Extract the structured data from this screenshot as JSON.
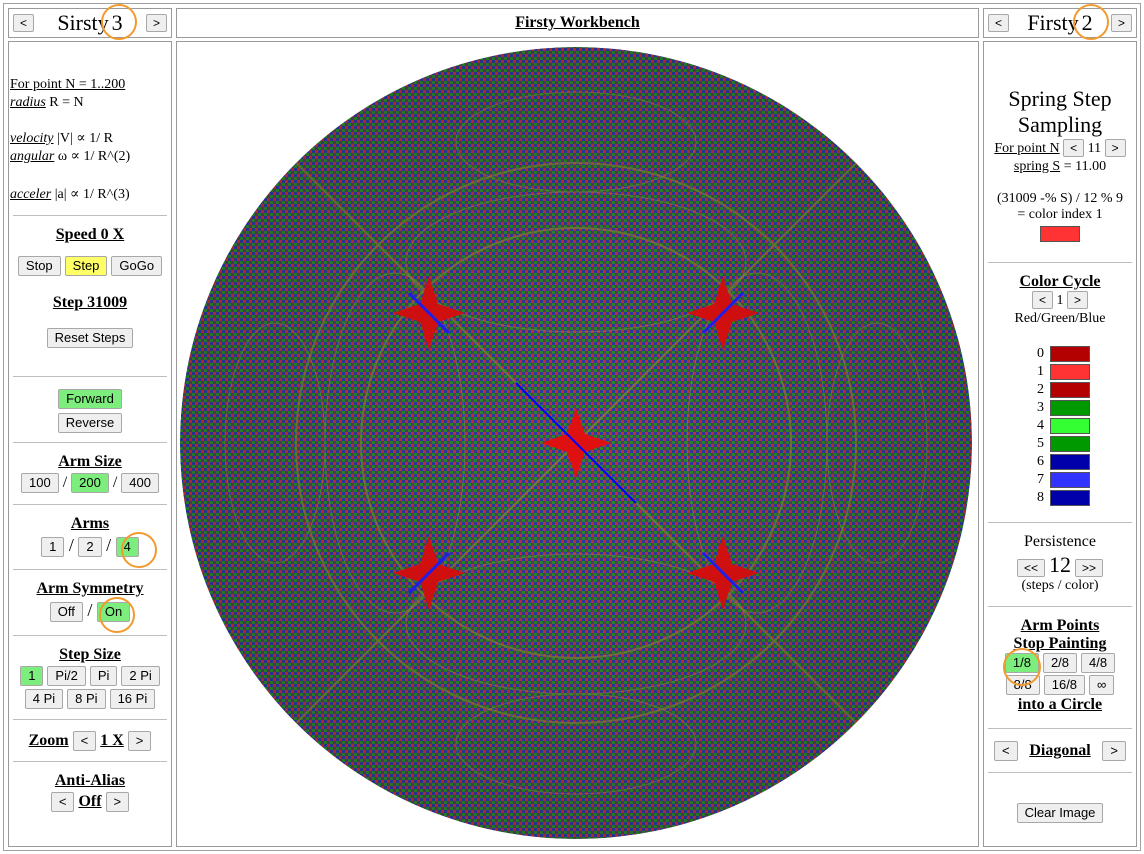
{
  "left_header": {
    "prev": "<",
    "title": "Sirsty",
    "num": "3",
    "next": ">"
  },
  "center_header": {
    "title": "Firsty Workbench"
  },
  "right_header": {
    "prev": "<",
    "title": "Firsty",
    "num": "2",
    "next": ">"
  },
  "formulas": {
    "l1_link": "For point N = 1..200",
    "l2_link": "radius",
    "l2_rest": " R = N",
    "l3_link": "velocity",
    "l3_rest": " |V| ∝ 1/ R",
    "l4_link": "angular",
    "l4_rest": " ω ∝ 1/ R^(2)",
    "l5_link": "acceler",
    "l5_rest": " |a| ∝ 1/ R^(3)"
  },
  "speed": {
    "title": "Speed 0 X",
    "stop": "Stop",
    "step": "Step",
    "gogo": "GoGo"
  },
  "step_count": {
    "title": "Step 31009",
    "reset": "Reset Steps"
  },
  "direction": {
    "forward": "Forward",
    "reverse": "Reverse"
  },
  "arm_size": {
    "title": "Arm Size",
    "opt1": "100",
    "opt2": "200",
    "opt3": "400",
    "sep": "/"
  },
  "arms": {
    "title": "Arms",
    "opt1": "1",
    "opt2": "2",
    "opt3": "4",
    "sep": "/"
  },
  "arm_symmetry": {
    "title": "Arm Symmetry",
    "off": "Off",
    "on": "On",
    "sep": "/"
  },
  "step_size": {
    "title": "Step Size",
    "o1": "1",
    "o2": "Pi/2",
    "o3": "Pi",
    "o4": "2 Pi",
    "o5": "4 Pi",
    "o6": "8 Pi",
    "o7": "16 Pi"
  },
  "zoom": {
    "title": "Zoom",
    "prev": "<",
    "value": "1 X",
    "next": ">"
  },
  "anti_alias": {
    "title": "Anti-Alias",
    "prev": "<",
    "value": "Off",
    "next": ">"
  },
  "spring": {
    "title1": "Spring Step",
    "title2": "Sampling",
    "point_label": "For point N",
    "prev": "<",
    "point_value": "11",
    "next": ">",
    "spring_link": "spring S",
    "spring_rest": " = 11.00",
    "formula": "(31009 -% S) / 12 % 9",
    "color_index": "= color index 1"
  },
  "color_cycle": {
    "title": "Color Cycle",
    "prev": "<",
    "value": "1",
    "next": ">",
    "subtitle": "Red/Green/Blue",
    "swatches": [
      {
        "n": "0",
        "color": "#b30000"
      },
      {
        "n": "1",
        "color": "#ff3333"
      },
      {
        "n": "2",
        "color": "#b30000"
      },
      {
        "n": "3",
        "color": "#009900"
      },
      {
        "n": "4",
        "color": "#33ff33"
      },
      {
        "n": "5",
        "color": "#009900"
      },
      {
        "n": "6",
        "color": "#0000aa"
      },
      {
        "n": "7",
        "color": "#3333ff"
      },
      {
        "n": "8",
        "color": "#0000aa"
      }
    ]
  },
  "persistence": {
    "title": "Persistence",
    "prev": "<<",
    "value": "12",
    "next": ">>",
    "unit": "(steps / color)"
  },
  "arm_points": {
    "title1": "Arm Points",
    "title2": "Stop Painting",
    "o1": "1/8",
    "o2": "2/8",
    "o3": "4/8",
    "o4": "8/8",
    "o5": "16/8",
    "o6": "∞",
    "title3": "into a Circle"
  },
  "diagonal": {
    "prev": "<",
    "label": "Diagonal",
    "next": ">"
  },
  "clear": {
    "label": "Clear Image"
  },
  "colors": {
    "red": "#ff0000",
    "green": "#00cc00",
    "blue": "#0000ff",
    "highlight": "#f29a2e",
    "on_button": "#7ded7d",
    "step_button": "#ffff66"
  }
}
